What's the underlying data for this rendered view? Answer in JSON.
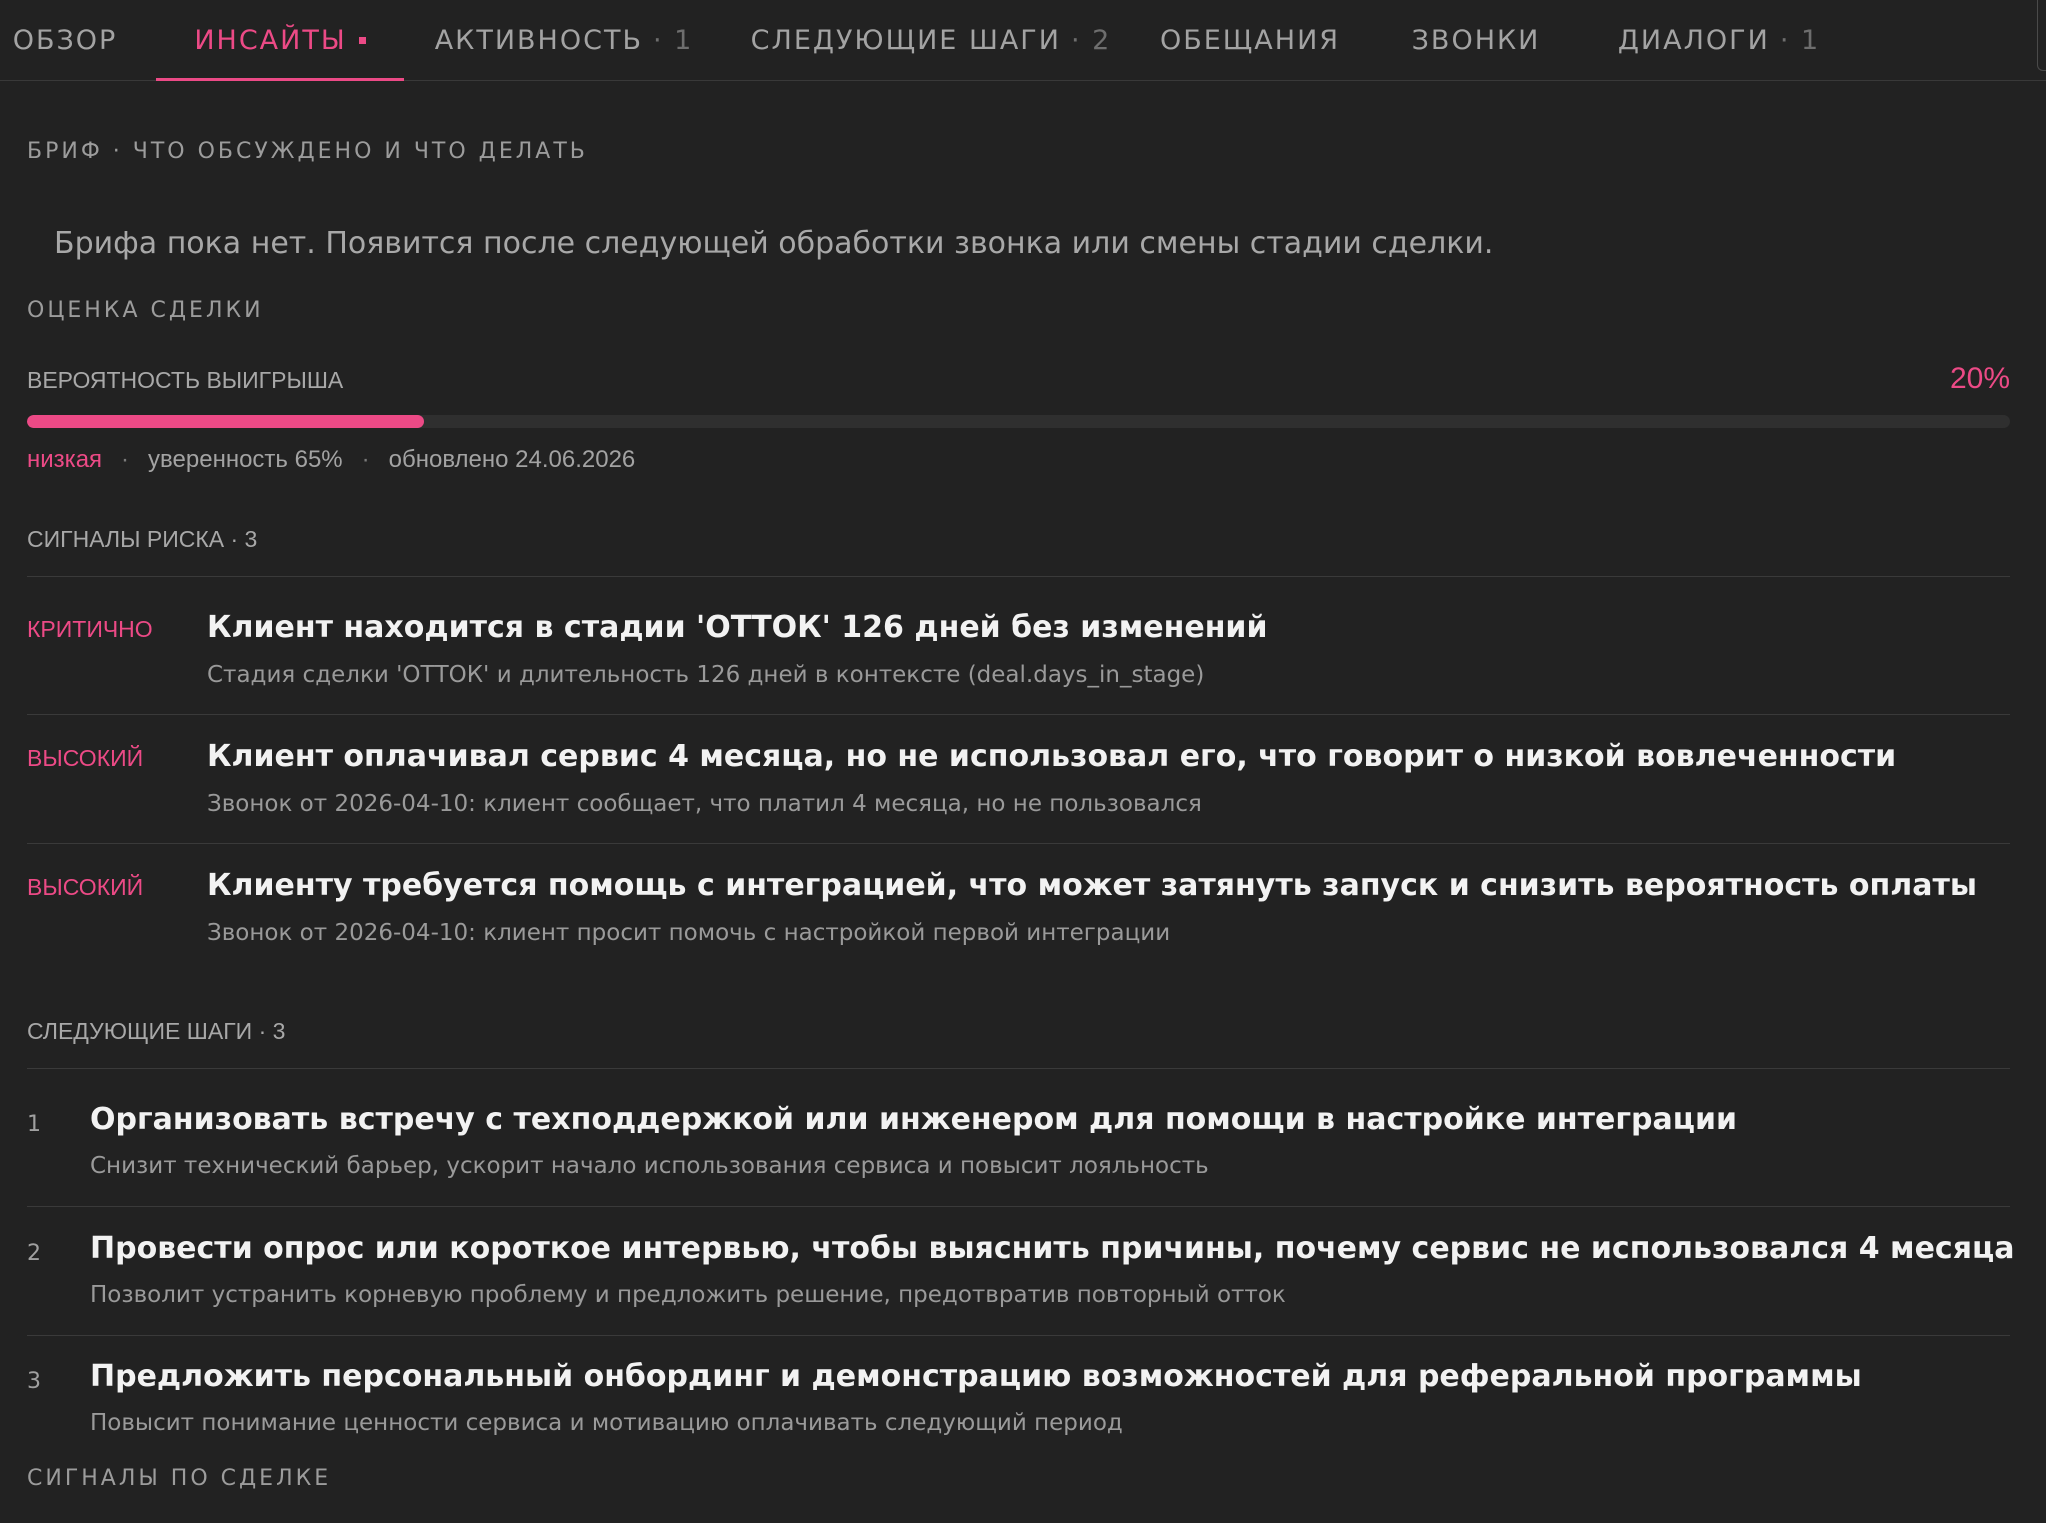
{
  "tabs": [
    {
      "label": "ОБЗОР",
      "count": ""
    },
    {
      "label": "ИНСАЙТЫ",
      "count": ""
    },
    {
      "label": "АКТИВНОСТЬ",
      "count": "· 1"
    },
    {
      "label": "СЛЕДУЮЩИЕ ШАГИ",
      "count": "· 2"
    },
    {
      "label": "ОБЕЩАНИЯ",
      "count": ""
    },
    {
      "label": "ЗВОНКИ",
      "count": ""
    },
    {
      "label": "ДИАЛОГИ",
      "count": "· 1"
    }
  ],
  "active_tab": "ИНСАЙТЫ",
  "brief": {
    "label": "БРИФ · ЧТО ОБСУЖДЕНО И ЧТО ДЕЛАТЬ",
    "empty_text": "Брифа пока нет. Появится после следующей обработки звонка или смены стадии сделки."
  },
  "assessment": {
    "label": "ОЦЕНКА СДЕЛКИ",
    "win_label": "ВЕРОЯТНОСТЬ ВЫИГРЫША",
    "win_value": "20%",
    "win_fraction": 0.2,
    "level": "низкая",
    "confidence": "уверенность 65%",
    "updated": "обновлено 24.06.2026"
  },
  "risks": {
    "label": "СИГНАЛЫ РИСКА · 3",
    "items": [
      {
        "level": "КРИТИЧНО",
        "title": "Клиент находится в стадии 'ОТТОК' 126 дней без изменений",
        "desc": "Стадия сделки 'ОТТОК' и длительность 126 дней в контексте (deal.days_in_stage)"
      },
      {
        "level": "ВЫСОКИЙ",
        "title": "Клиент оплачивал сервис 4 месяца, но не использовал его, что говорит о низкой вовлеченности",
        "desc": "Звонок от 2026-04-10: клиент сообщает, что платил 4 месяца, но не пользовался"
      },
      {
        "level": "ВЫСОКИЙ",
        "title": "Клиенту требуется помощь с интеграцией, что может затянуть запуск и снизить вероятность оплаты",
        "desc": "Звонок от 2026-04-10: клиент просит помочь с настройкой первой интеграции"
      }
    ]
  },
  "next_steps": {
    "label": "СЛЕДУЮЩИЕ ШАГИ · 3",
    "items": [
      {
        "num": "1",
        "title": "Организовать встречу с техподдержкой или инженером для помощи в настройке интеграции",
        "desc": "Снизит технический барьер, ускорит начало использования сервиса и повысит лояльность"
      },
      {
        "num": "2",
        "title": "Провести опрос или короткое интервью, чтобы выяснить причины, почему сервис не использовался 4 месяца",
        "desc": "Позволит устранить корневую проблему и предложить решение, предотвратив повторный отток"
      },
      {
        "num": "3",
        "title": "Предложить персональный онбординг и демонстрацию возможностей для реферальной программы",
        "desc": "Повысит понимание ценности сервиса и мотивацию оплачивать следующий период"
      }
    ]
  },
  "deal_signals": {
    "label": "СИГНАЛЫ ПО СДЕЛКЕ"
  },
  "colors": {
    "accent": "#ec4a86",
    "background": "#222222"
  }
}
